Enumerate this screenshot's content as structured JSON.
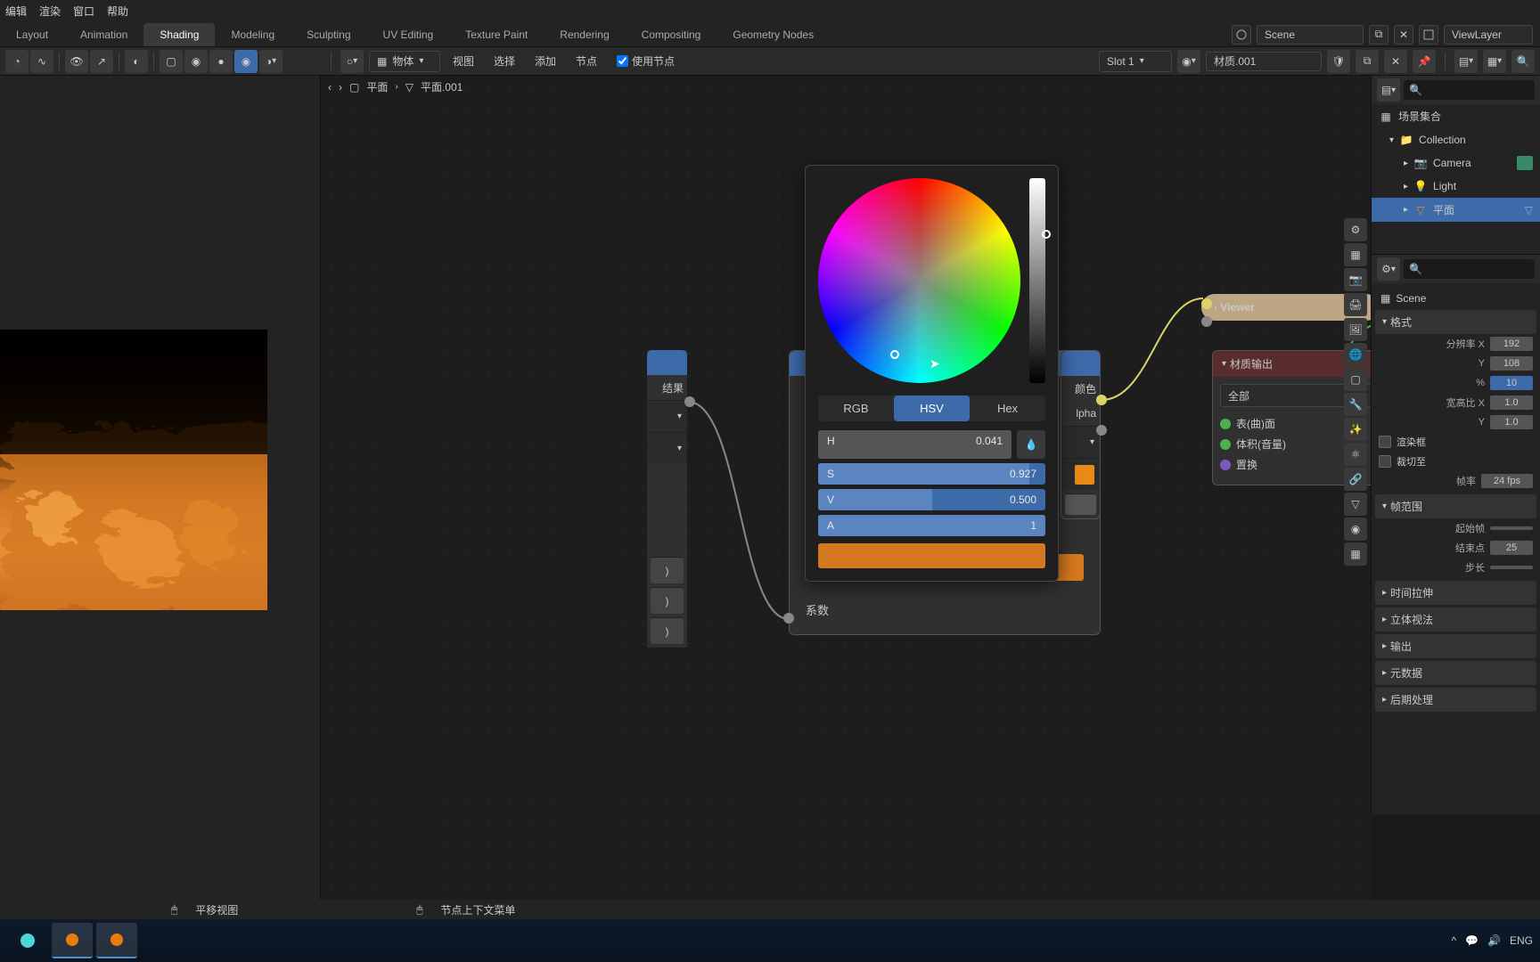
{
  "menubar": {
    "edit": "编辑",
    "render": "渲染",
    "window": "窗口",
    "help": "帮助"
  },
  "workspaces": {
    "layout": "Layout",
    "animation": "Animation",
    "shading": "Shading",
    "modeling": "Modeling",
    "sculpting": "Sculpting",
    "uv": "UV Editing",
    "texture": "Texture Paint",
    "rendering": "Rendering",
    "compositing": "Compositing",
    "geonodes": "Geometry Nodes"
  },
  "header": {
    "scene": "Scene",
    "viewlayer": "ViewLayer"
  },
  "toolbar": {
    "object_mode": "物体",
    "view": "视图",
    "select": "选择",
    "add": "添加",
    "node": "节点",
    "use_nodes": "使用节点",
    "slot": "Slot 1",
    "material": "材质.001"
  },
  "breadcrumb": {
    "obj": "平面",
    "data": "平面.001"
  },
  "node_left": {
    "result": "结果"
  },
  "node_mid": {
    "xishu": "系数",
    "color": "颜色",
    "alpha": "lpha"
  },
  "color_picker": {
    "tabs": {
      "rgb": "RGB",
      "hsv": "HSV",
      "hex": "Hex"
    },
    "h": {
      "label": "H",
      "val": "0.041"
    },
    "s": {
      "label": "S",
      "val": "0.927"
    },
    "v": {
      "label": "V",
      "val": "0.500"
    },
    "a": {
      "label": "A",
      "val": "1"
    }
  },
  "viewer": {
    "title": "Viewer"
  },
  "mat_output": {
    "title": "材质输出",
    "all": "全部",
    "surface": "表(曲)面",
    "volume": "体积(音量)",
    "displacement": "置换"
  },
  "outliner": {
    "scene_coll": "场景集合",
    "collection": "Collection",
    "camera": "Camera",
    "light": "Light",
    "plane": "平面"
  },
  "props": {
    "scene": "Scene",
    "format": "格式",
    "res_x": {
      "label": "分辨率 X",
      "val": "192"
    },
    "res_y": {
      "label": "Y",
      "val": "108"
    },
    "res_pct": {
      "label": "%",
      "val": "10"
    },
    "aspect_x": {
      "label": "宽高比 X",
      "val": "1.0"
    },
    "aspect_y": {
      "label": "Y",
      "val": "1.0"
    },
    "border": "渲染框",
    "crop": "裁切至",
    "fps": {
      "label": "帧率",
      "val": "24 fps"
    },
    "frame_range": "帧范围",
    "start": {
      "label": "起始帧",
      "val": ""
    },
    "end": {
      "label": "结束点",
      "val": "25"
    },
    "step": {
      "label": "步长",
      "val": ""
    },
    "time_stretch": "时间拉伸",
    "stereo": "立体视法",
    "output": "输出",
    "metadata": "元数据",
    "post": "后期处理"
  },
  "statusbar": {
    "pan": "平移视图",
    "context": "节点上下文菜单"
  },
  "taskbar": {
    "lang": "ENG"
  }
}
